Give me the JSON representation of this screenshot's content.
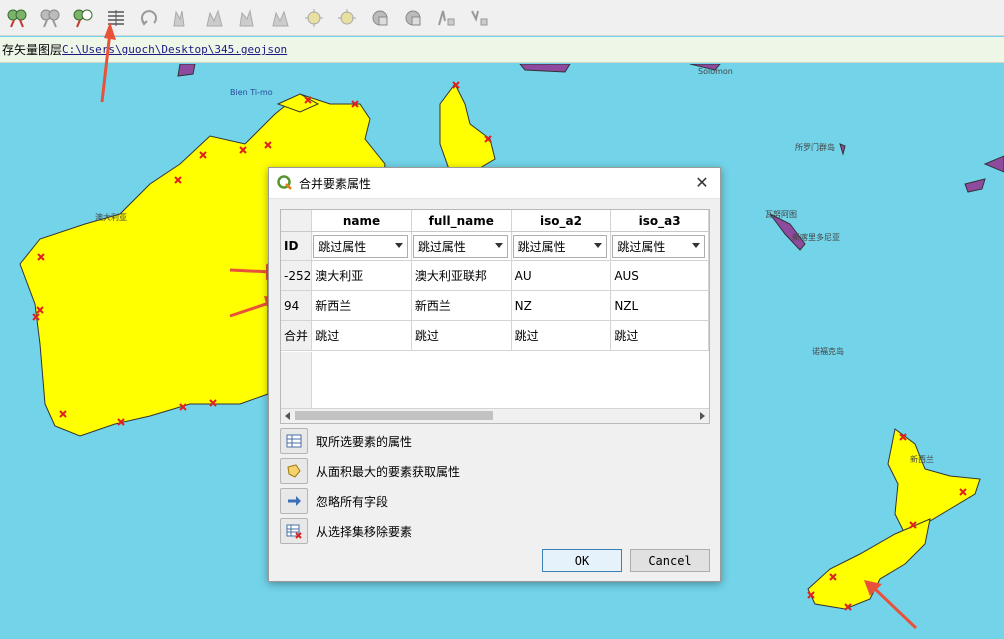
{
  "toolbar": {
    "icons": [
      "select-feature-icon",
      "deselect-icon",
      "select-value-icon",
      "merge-attributes-icon",
      "rotate-icon",
      "simplify-icon",
      "add-ring-icon",
      "fill-ring-icon",
      "delete-ring-icon",
      "add-part-icon",
      "delete-part-icon",
      "reshape-icon",
      "offset-icon",
      "split-icon",
      "split-parts-icon"
    ]
  },
  "status": {
    "prefix": "存矢量图层",
    "path": "C:\\Users\\guoch\\Desktop\\345.geojson"
  },
  "map": {
    "labels": [
      "Solomon",
      "Bien Ti-mo",
      "所罗门群岛",
      "瓦努阿图",
      "新喀里多尼亚",
      "诺福克岛",
      "新西兰",
      "澳大利亚"
    ]
  },
  "dialog": {
    "title": "合并要素属性",
    "close_label": "✕",
    "columns": [
      "name",
      "full_name",
      "iso_a2",
      "iso_a3"
    ],
    "id_header": "ID",
    "skip_label": "跳过属性",
    "rows": [
      {
        "id": "-252",
        "values": [
          "澳大利亚",
          "澳大利亚联邦",
          "AU",
          "AUS"
        ]
      },
      {
        "id": "94",
        "values": [
          "新西兰",
          "新西兰",
          "NZ",
          "NZL"
        ]
      },
      {
        "id": "合并",
        "values": [
          "跳过",
          "跳过",
          "跳过",
          "跳过"
        ]
      }
    ],
    "actions": [
      "取所选要素的属性",
      "从面积最大的要素获取属性",
      "忽略所有字段",
      "从选择集移除要素"
    ],
    "ok_label": "OK",
    "cancel_label": "Cancel"
  },
  "colors": {
    "land": "#ffff00",
    "sea": "#72d3e9",
    "vertex": "#e02020",
    "arrow": "#e8523a",
    "islands": "#8e4a9e"
  }
}
